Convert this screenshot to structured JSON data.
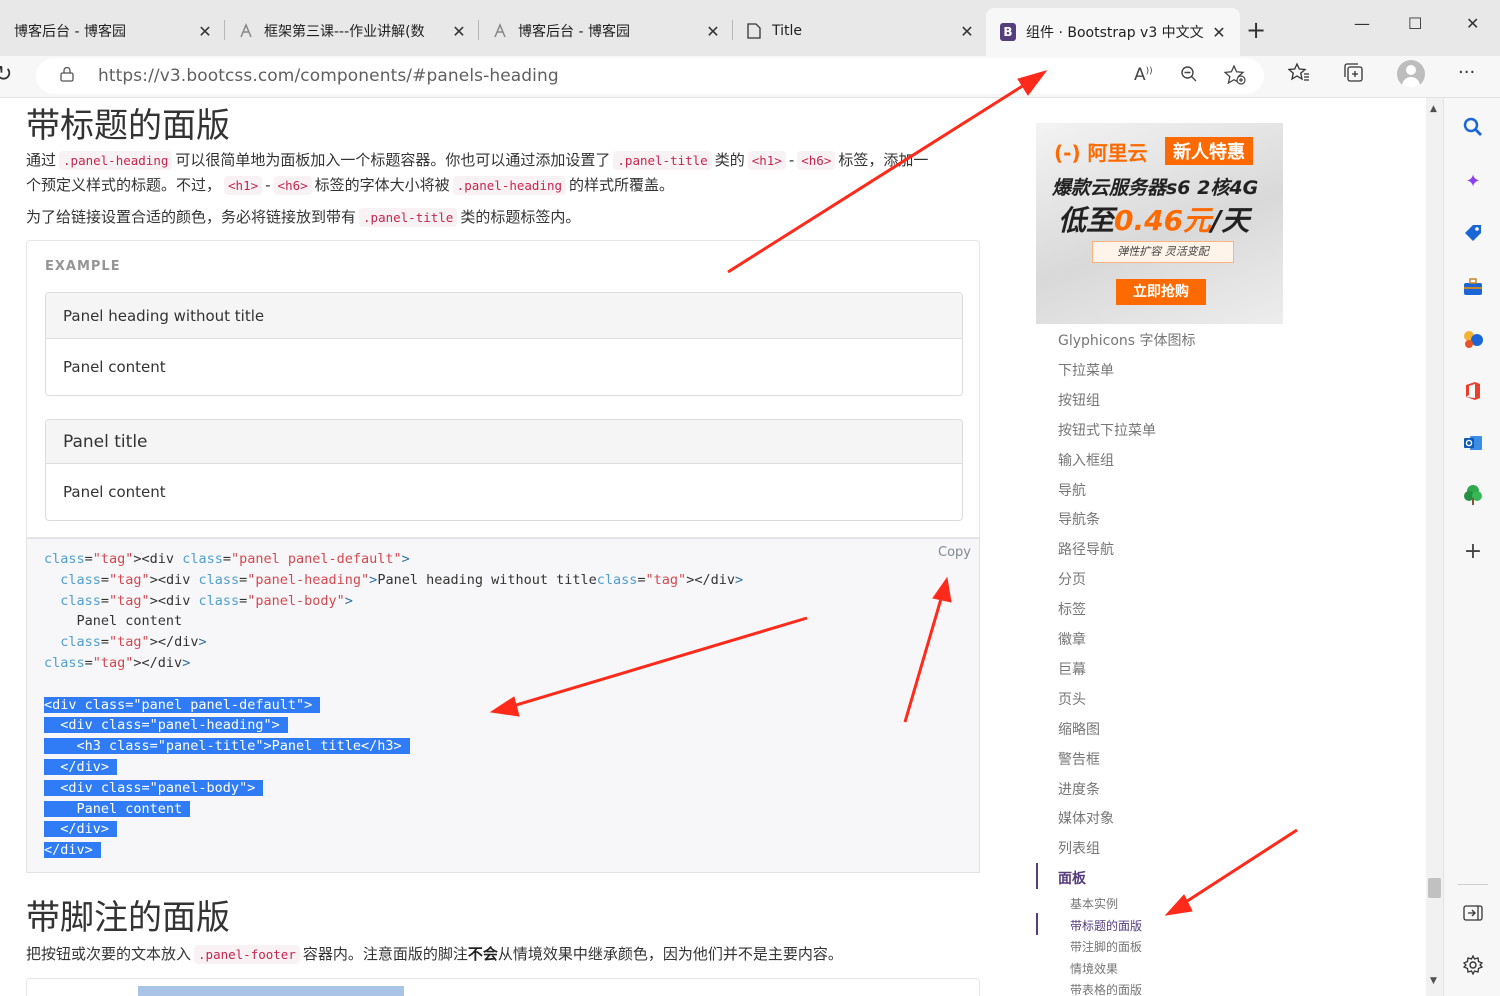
{
  "browser": {
    "tabs": [
      {
        "title": "博客后台 - 博客园",
        "icon": "cnblogs-icon"
      },
      {
        "title": "框架第三课---作业讲解(数",
        "icon": "cnblogs-icon"
      },
      {
        "title": "博客后台 - 博客园",
        "icon": "cnblogs-icon"
      },
      {
        "title": "Title",
        "icon": "document-icon"
      },
      {
        "title": "组件 · Bootstrap v3 中文文",
        "icon": "bootstrap-icon",
        "active": true
      }
    ],
    "new_tab": "+",
    "url": "https://v3.bootcss.com/components/#panels-heading",
    "window_controls": {
      "minimize": "—",
      "maximize": "☐",
      "close": "✕"
    }
  },
  "page": {
    "section_title": "带标题的面版",
    "para1": {
      "t1": "通过",
      "c1": ".panel-heading",
      "t2": "可以很简单地为面板加入一个标题容器。你也可以通过添加设置了",
      "c2": ".panel-title",
      "t3": "类的",
      "c3": "<h1>",
      "dash1": "-",
      "c4": "<h6>",
      "t4": "标签，添加一",
      "t5": "个预定义样式的标题。不过，",
      "c5": "<h1>",
      "dash2": "-",
      "c6": "<h6>",
      "t6": "标签的字体大小将被",
      "c7": ".panel-heading",
      "t7": "的样式所覆盖。"
    },
    "para2": {
      "t1": "为了给链接设置合适的颜色，务必将链接放到带有",
      "c1": ".panel-title",
      "t2": "类的标题标签内。"
    },
    "example_label": "EXAMPLE",
    "panel1": {
      "heading": "Panel heading without title",
      "body": "Panel content"
    },
    "panel2": {
      "title": "Panel title",
      "body": "Panel content"
    },
    "copy_label": "Copy",
    "code_lines": [
      "<div class=\"panel panel-default\">",
      "  <div class=\"panel-heading\">Panel heading without title</div>",
      "  <div class=\"panel-body\">",
      "    Panel content",
      "  </div>",
      "</div>",
      "",
      "<div class=\"panel panel-default\">",
      "  <div class=\"panel-heading\">",
      "    <h3 class=\"panel-title\">Panel title</h3>",
      "  </div>",
      "  <div class=\"panel-body\">",
      "    Panel content",
      "  </div>",
      "</div>"
    ],
    "selected_from_line": 7,
    "footer_section_title": "带脚注的面版",
    "para3": {
      "t1": "把按钮或次要的文本放入",
      "c1": ".panel-footer",
      "t2": "容器内。注意面版的脚注",
      "b1": "不会",
      "t3": "从情境效果中继承颜色，因为他们并不是主要内容。"
    }
  },
  "ad": {
    "brand": "(-) 阿里云",
    "badge": "新人特惠",
    "line1": "爆款云服务器s6 2核4G",
    "line2_prefix": "低至",
    "line2_price": "0.46元",
    "line2_suffix": "/天",
    "tag": "弹性扩容 灵活变配",
    "cta": "立即抢购"
  },
  "sidenav": {
    "items": [
      "Glyphicons 字体图标",
      "下拉菜单",
      "按钮组",
      "按钮式下拉菜单",
      "输入框组",
      "导航",
      "导航条",
      "路径导航",
      "分页",
      "标签",
      "徽章",
      "巨幕",
      "页头",
      "缩略图",
      "警告框",
      "进度条",
      "媒体对象",
      "列表组",
      "面板"
    ],
    "active_item": "面板",
    "sub_items": [
      "基本实例",
      "带标题的面版",
      "带注脚的面板",
      "情境效果",
      "带表格的面版"
    ],
    "active_sub": "带标题的面版"
  },
  "colors": {
    "accent": "#563d7c",
    "arrow": "#ff2a1a",
    "selection": "#2f7cf6",
    "code_pink": "#c7254e"
  }
}
